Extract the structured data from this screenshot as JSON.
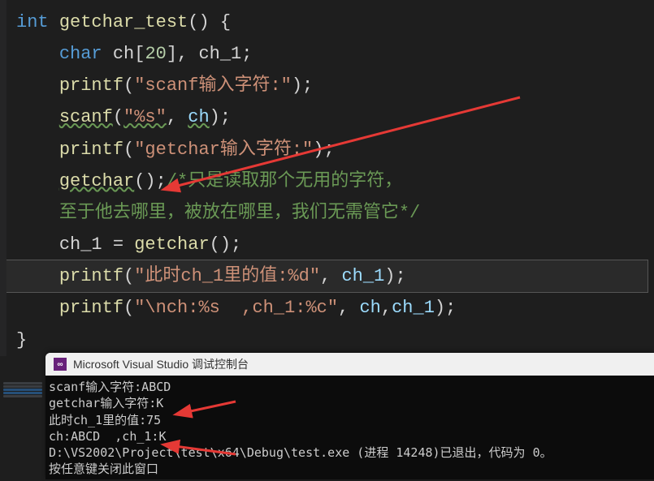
{
  "code": {
    "l1": {
      "type": "int",
      "name": "getchar_test",
      "after": "() {"
    },
    "l2": {
      "type": "char",
      "decl": " ch[",
      "size": "20",
      "decl2": "], ch_1;"
    },
    "l3": {
      "fn": "printf",
      "open": "(",
      "str": "\"scanf输入字符:\"",
      "close": ");"
    },
    "l4": {
      "fn": "scanf",
      "open": "(",
      "str": "\"%s\"",
      "sep": ", ",
      "arg": "ch",
      "close": ");"
    },
    "l5": {
      "fn": "printf",
      "open": "(",
      "str": "\"getchar输入字符:\"",
      "close": ");"
    },
    "l6": {
      "fn": "getchar",
      "open": "()",
      "close": ";",
      "comment1": "/*只是读取那个无用的字符，"
    },
    "l7": {
      "comment2": "至于他去哪里，被放在哪里，我们无需管它*/"
    },
    "l8": {
      "lhs": "ch_1 = ",
      "fn": "getchar",
      "call": "();"
    },
    "l9": {
      "fn": "printf",
      "open": "(",
      "str": "\"此时ch_1里的值:%d\"",
      "sep": ", ",
      "arg": "ch_1",
      "close": ");"
    },
    "l10": {
      "fn": "printf",
      "open": "(",
      "str": "\"\\nch:%s  ,ch_1:%c\"",
      "sep": ", ",
      "arg1": "ch",
      "sep2": ",",
      "arg2": "ch_1",
      "close": ");"
    },
    "l11": {
      "brace": "}"
    }
  },
  "console": {
    "title": "Microsoft Visual Studio 调试控制台",
    "lines": [
      "scanf输入字符:ABCD",
      "getchar输入字符:K",
      "此时ch_1里的值:75",
      "ch:ABCD  ,ch_1:K",
      "D:\\VS2002\\Project\\test\\x64\\Debug\\test.exe (进程 14248)已退出，代码为 0。",
      "按任意键关闭此窗口"
    ]
  }
}
